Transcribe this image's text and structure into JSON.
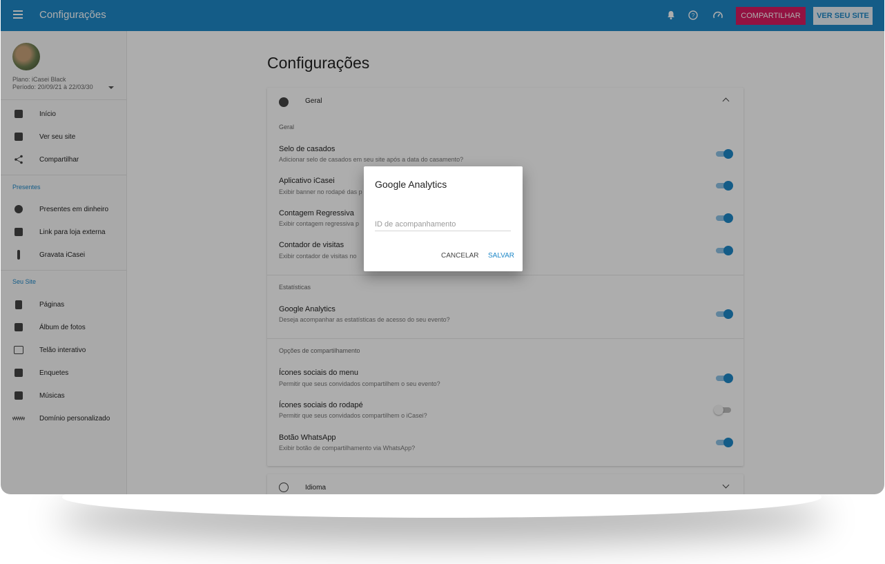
{
  "topbar": {
    "title": "Configurações",
    "share_label": "COMPARTILHAR",
    "site_label": "VER SEU SITE",
    "icons": [
      "menu-icon",
      "bell-icon",
      "help-icon",
      "speed-icon"
    ]
  },
  "sidebar": {
    "plan": "Plano: iCasei Black",
    "period": "Período: 20/09/21 à 22/03/30",
    "items": [
      {
        "label": "Início",
        "icon": "dashboard-icon"
      },
      {
        "label": "Ver seu site",
        "icon": "web-icon"
      },
      {
        "label": "Compartilhar",
        "icon": "share-icon"
      }
    ],
    "sections": [
      {
        "title": "Presentes",
        "items": [
          {
            "label": "Presentes em dinheiro",
            "icon": "money-icon"
          },
          {
            "label": "Link para loja externa",
            "icon": "store-icon"
          },
          {
            "label": "Gravata iCasei",
            "icon": "tie-icon"
          }
        ]
      },
      {
        "title": "Seu Site",
        "items": [
          {
            "label": "Páginas",
            "icon": "page-icon"
          },
          {
            "label": "Álbum de fotos",
            "icon": "camera-icon"
          },
          {
            "label": "Telão interativo",
            "icon": "screen-icon"
          },
          {
            "label": "Enquetes",
            "icon": "poll-icon"
          },
          {
            "label": "Músicas",
            "icon": "music-icon"
          },
          {
            "label": "Domínio personalizado",
            "icon": "www-icon"
          }
        ]
      }
    ]
  },
  "main": {
    "title": "Configurações",
    "card": {
      "header": "Geral",
      "groups": [
        {
          "label": "Geral",
          "settings": [
            {
              "title": "Selo de casados",
              "desc": "Adicionar selo de casados em seu site após a data do casamento?",
              "on": true
            },
            {
              "title": "Aplicativo iCasei",
              "desc": "Exibir banner no rodapé das p",
              "on": true
            },
            {
              "title": "Contagem Regressiva",
              "desc": "Exibir contagem regressiva p",
              "on": true
            },
            {
              "title": "Contador de visitas",
              "desc": "Exibir contador de visitas no",
              "on": true
            }
          ]
        },
        {
          "label": "Estatísticas",
          "settings": [
            {
              "title": "Google Analytics",
              "desc": "Deseja acompanhar as estatísticas de acesso do seu evento?",
              "on": true
            }
          ]
        },
        {
          "label": "Opções de compartilhamento",
          "settings": [
            {
              "title": "Ícones sociais do menu",
              "desc": "Permitir que seus convidados compartilhem o seu evento?",
              "on": true
            },
            {
              "title": "Ícones sociais do rodapé",
              "desc": "Permitir que seus convidados compartilhem o iCasei?",
              "on": false
            },
            {
              "title": "Botão WhatsApp",
              "desc": "Exibir botão de compartilhamento via WhatsApp?",
              "on": true
            }
          ]
        }
      ]
    },
    "card2": {
      "header": "Idioma"
    }
  },
  "dialog": {
    "title": "Google Analytics",
    "input_placeholder": "ID de acompanhamento",
    "input_value": "",
    "cancel_label": "CANCELAR",
    "save_label": "SALVAR"
  },
  "colors": {
    "primary": "#1e88c8",
    "accent": "#d81b60"
  }
}
